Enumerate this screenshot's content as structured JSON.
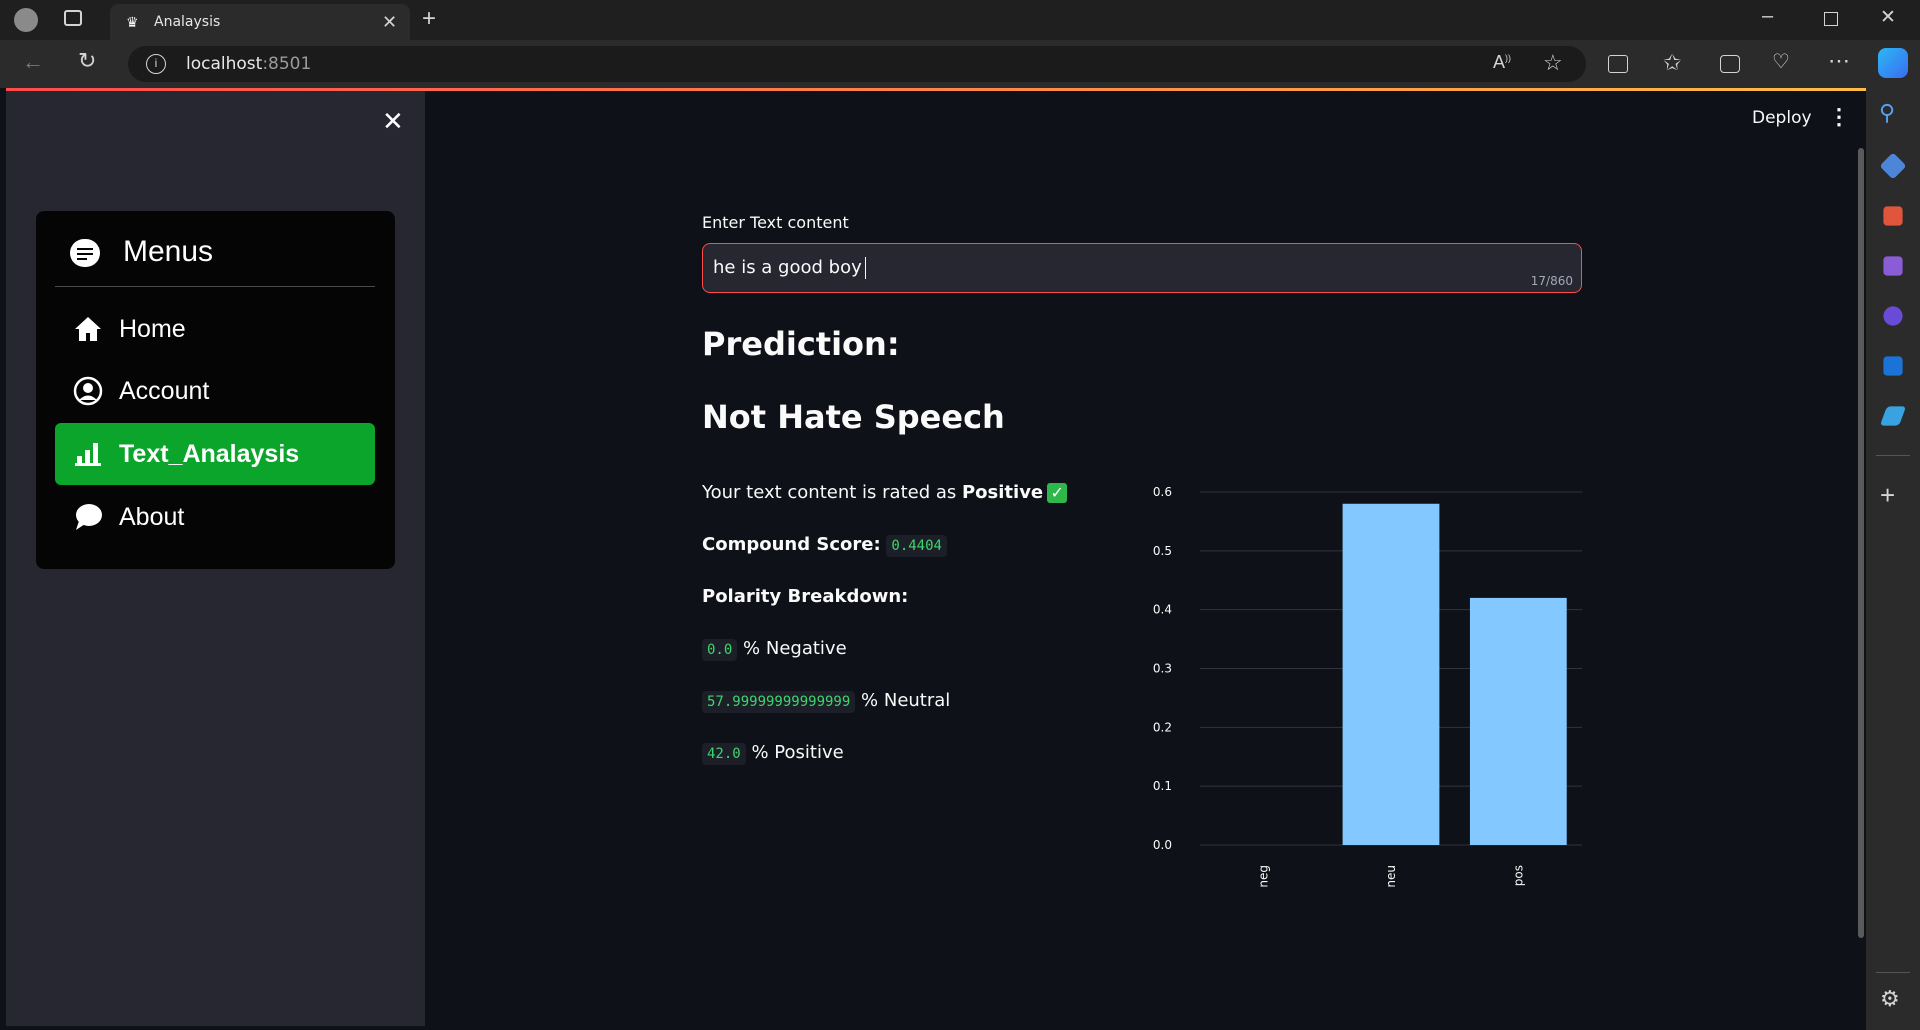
{
  "browser": {
    "tab_title": "Analaysis",
    "url_host": "localhost",
    "url_port": ":8501"
  },
  "app": {
    "deploy_label": "Deploy",
    "sidebar": {
      "menu_title": "Menus",
      "items": [
        {
          "label": "Home",
          "icon": "house-icon",
          "active": false
        },
        {
          "label": "Account",
          "icon": "person-circle-icon",
          "active": false
        },
        {
          "label": "Text_Analaysis",
          "icon": "bar-chart-icon",
          "active": true
        },
        {
          "label": "About",
          "icon": "chat-bubble-icon",
          "active": false
        }
      ]
    },
    "input": {
      "label": "Enter Text content",
      "value": "he is a good boy",
      "counter": "17/860"
    },
    "prediction_heading": "Prediction:",
    "prediction_result": "Not Hate Speech",
    "rating_prefix": "Your text content is rated as ",
    "rating_value": "Positive",
    "compound_label": "Compound Score:",
    "compound_value": "0.4404",
    "polarity_label": "Polarity Breakdown:",
    "polarity": [
      {
        "value": "0.0",
        "label": "% Negative"
      },
      {
        "value": "57.99999999999999",
        "label": "% Neutral"
      },
      {
        "value": "42.0",
        "label": "% Positive"
      }
    ]
  },
  "colors": {
    "accent_red": "#ff4b4b",
    "active_menu": "#0ba52c",
    "bar": "#83c9ff",
    "code_text": "#3dd56d"
  },
  "chart_data": {
    "type": "bar",
    "categories": [
      "neg",
      "neu",
      "pos"
    ],
    "values": [
      0.0,
      0.58,
      0.42
    ],
    "yticks": [
      "0.0",
      "0.1",
      "0.2",
      "0.3",
      "0.4",
      "0.5",
      "0.6"
    ],
    "ylim": [
      0,
      0.6
    ],
    "grid": true,
    "title": "",
    "xlabel": "",
    "ylabel": ""
  }
}
